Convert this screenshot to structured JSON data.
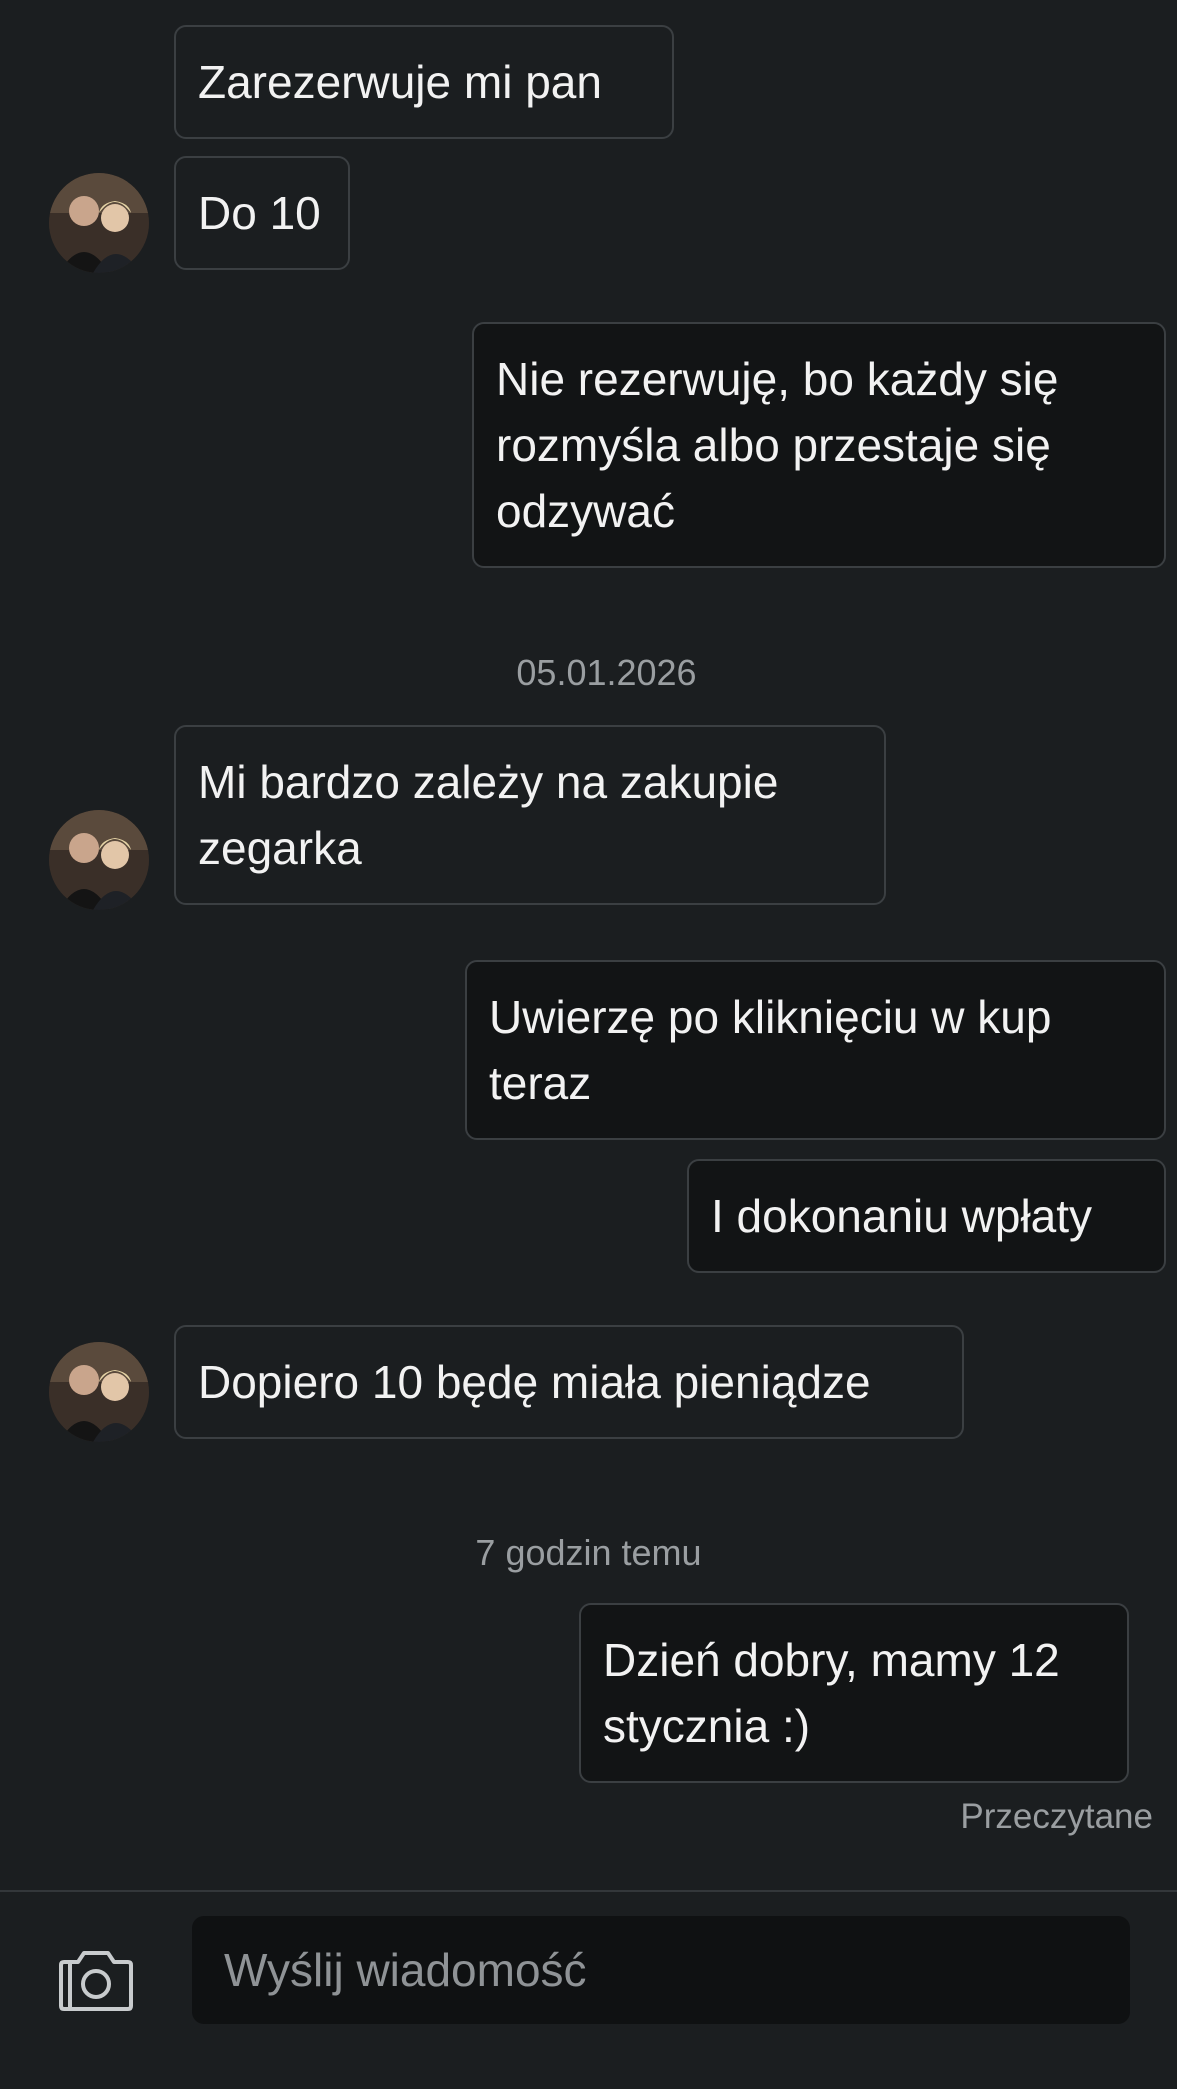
{
  "conversation": {
    "messages": [
      {
        "direction": "in",
        "text": "Zarezerwuje mi pan"
      },
      {
        "direction": "in",
        "text": "Do 10"
      },
      {
        "direction": "out",
        "text": "Nie rezerwuję, bo każdy się rozmyśla albo przestaje się odzywać"
      },
      {
        "direction": "in",
        "text": "Mi bardzo zależy na zakupie zegarka"
      },
      {
        "direction": "out",
        "text": "Uwierzę po kliknięciu w kup teraz"
      },
      {
        "direction": "out",
        "text": "I dokonaniu wpłaty"
      },
      {
        "direction": "in",
        "text": "Dopiero 10 będę miała pieniądze"
      },
      {
        "direction": "out",
        "text": "Dzień dobry, mamy 12 stycznia :)"
      }
    ],
    "separators": [
      "05.01.2026",
      "7 godzin temu"
    ],
    "read_status": "Przeczytane"
  },
  "composer": {
    "placeholder": "Wyślij wiadomość",
    "value": "",
    "camera_icon": "camera-icon"
  },
  "colors": {
    "background": "#1b1e20",
    "incoming_bubble": "#1b1e20",
    "outgoing_bubble": "#121415",
    "bubble_border": "#3b3f42",
    "muted_text": "#9a9ea1"
  }
}
